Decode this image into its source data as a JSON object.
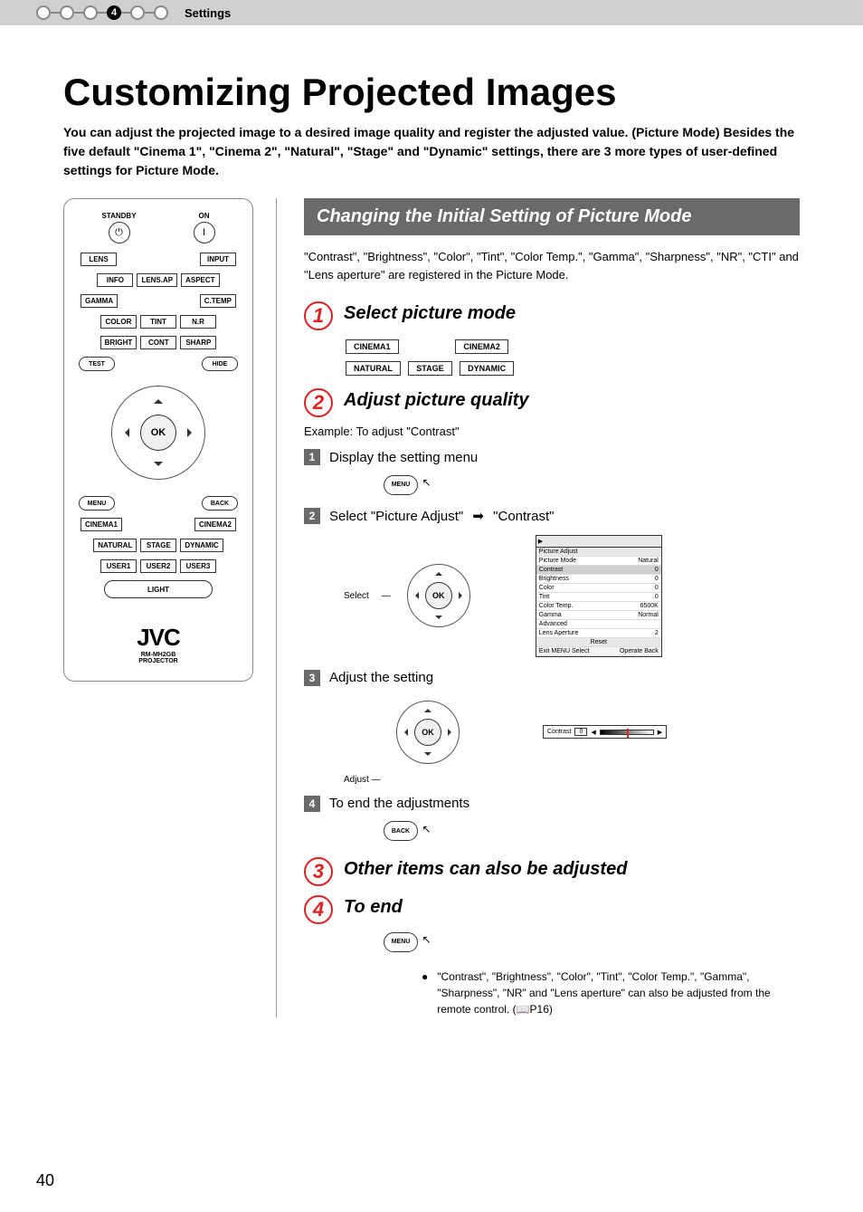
{
  "header": {
    "section": "Settings",
    "active_step": "4"
  },
  "title": "Customizing Projected Images",
  "intro": "You can adjust the projected image to a desired image quality and register the adjusted value. (Picture Mode) Besides the five default \"Cinema 1\", \"Cinema 2\", \"Natural\", \"Stage\" and \"Dynamic\" settings, there are 3 more types of user-defined settings for Picture Mode.",
  "remote": {
    "standby": "STANDBY",
    "on": "ON",
    "lens": "LENS",
    "input": "INPUT",
    "info": "INFO",
    "lensap": "LENS.AP",
    "aspect": "ASPECT",
    "gamma": "GAMMA",
    "ctemp": "C.TEMP",
    "color": "COLOR",
    "tint": "TINT",
    "nr": "N.R",
    "bright": "BRIGHT",
    "cont": "CONT",
    "sharp": "SHARP",
    "test": "TEST",
    "hide": "HIDE",
    "ok": "OK",
    "menu": "MENU",
    "back": "BACK",
    "cinema1": "CINEMA1",
    "cinema2": "CINEMA2",
    "natural": "NATURAL",
    "stage": "STAGE",
    "dynamic": "DYNAMIC",
    "user1": "USER1",
    "user2": "USER2",
    "user3": "USER3",
    "light": "LIGHT",
    "logo": "JVC",
    "model": "RM-MH2GB",
    "sub": "PROJECTOR"
  },
  "banner": "Changing the Initial Setting of Picture Mode",
  "desc": "\"Contrast\", \"Brightness\", \"Color\", \"Tint\", \"Color Temp.\", \"Gamma\", \"Sharpness\", \"NR\", \"CTI\" and \"Lens aperture\" are registered in the Picture Mode.",
  "steps": {
    "s1": {
      "n": "1",
      "title": "Select picture mode",
      "modes_row1": [
        "CINEMA1",
        "CINEMA2"
      ],
      "modes_row2": [
        "NATURAL",
        "STAGE",
        "DYNAMIC"
      ]
    },
    "s2": {
      "n": "2",
      "title": "Adjust picture quality",
      "example": "Example: To adjust \"Contrast\"",
      "sub1": {
        "n": "1",
        "text": "Display the setting menu",
        "btn": "MENU"
      },
      "sub2": {
        "n": "2",
        "text_a": "Select \"Picture Adjust\"",
        "text_b": "\"Contrast\"",
        "select_label": "Select",
        "ok": "OK"
      },
      "sub3": {
        "n": "3",
        "text": "Adjust the setting",
        "adjust_label": "Adjust",
        "ok": "OK",
        "slider_name": "Contrast",
        "slider_val": "0"
      },
      "sub4": {
        "n": "4",
        "text": "To end the adjustments",
        "btn": "BACK"
      }
    },
    "s3": {
      "n": "3",
      "title": "Other items can also be adjusted"
    },
    "s4": {
      "n": "4",
      "title": "To end",
      "btn": "MENU"
    }
  },
  "menu_panel": {
    "header": "Picture Adjust",
    "rows": [
      {
        "k": "Picture Mode",
        "v": "Natural"
      },
      {
        "k": "Contrast",
        "v": "0",
        "sel": true
      },
      {
        "k": "Brightness",
        "v": "0"
      },
      {
        "k": "Color",
        "v": "0"
      },
      {
        "k": "Tint",
        "v": "0"
      },
      {
        "k": "Color Temp.",
        "v": "6500K"
      },
      {
        "k": "Gamma",
        "v": "Normal"
      },
      {
        "k": "Advanced",
        "v": ""
      },
      {
        "k": "Lens Aperture",
        "v": "2"
      },
      {
        "k": "Reset",
        "v": ""
      }
    ],
    "footer": {
      "exit": "Exit",
      "menu": "MENU",
      "select": "Select",
      "operate": "Operate",
      "back": "Back"
    }
  },
  "note": "\"Contrast\", \"Brightness\", \"Color\", \"Tint\", \"Color Temp.\", \"Gamma\", \"Sharpness\", \"NR\" and \"Lens aperture\" can also be adjusted from the remote control. (📖P16)",
  "page_number": "40"
}
